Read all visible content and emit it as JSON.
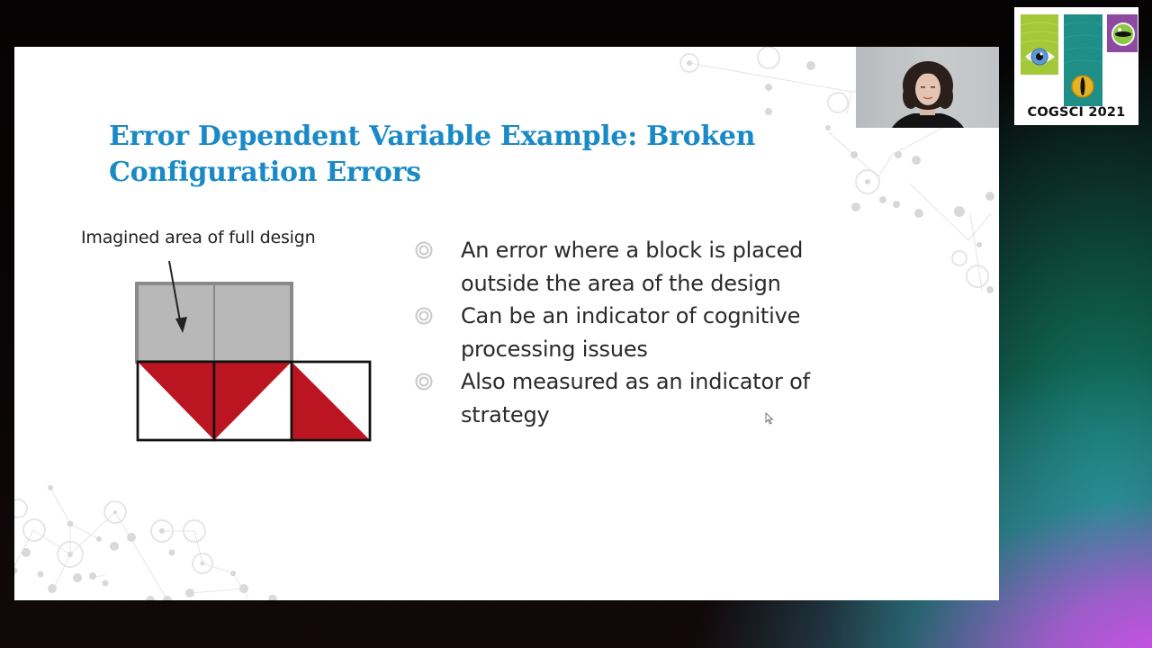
{
  "slide": {
    "title": "Error Dependent Variable Example: Broken Configuration Errors",
    "title_color": "#1a8ac6",
    "figure": {
      "label": "Imagined area of full design",
      "imagined_cells": 2,
      "placed_blocks": 3,
      "block_color": "#bb1522",
      "imagined_area_color": "#b8b8b8"
    },
    "bullets": [
      {
        "icon": "concentric-circle-bullet-icon",
        "text": "An error where a block is placed outside the area of the design"
      },
      {
        "icon": "concentric-circle-bullet-icon",
        "text": "Can be an indicator of cognitive processing issues"
      },
      {
        "icon": "concentric-circle-bullet-icon",
        "text": "Also measured as an indicator of strategy"
      }
    ]
  },
  "webcam": {
    "description": "Presenter video feed"
  },
  "logo": {
    "text": "COGSCI 2021",
    "colors": {
      "green": "#a3c93a",
      "teal": "#1f8e86",
      "purple": "#8d4aa0"
    }
  }
}
